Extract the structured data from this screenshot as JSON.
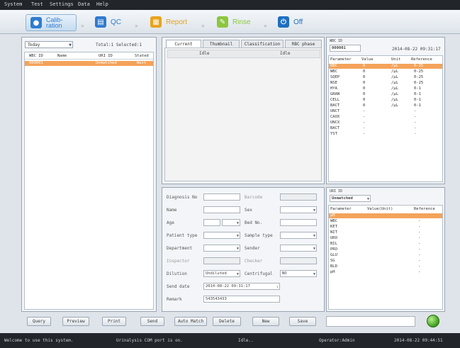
{
  "menu": [
    "System",
    "Test",
    "Settings",
    "Data",
    "Help"
  ],
  "toolbar": {
    "calibration": "Calib-\nration",
    "calibration_l1": "Calib-",
    "calibration_l2": "ration",
    "qc": "QC",
    "report": "Report",
    "rinse": "Rinse",
    "off": "Off",
    "colors": {
      "active": "#2f7bd0",
      "report": "#e8a21a",
      "rinse": "#8cc63f",
      "off": "#1f6fc0"
    }
  },
  "left": {
    "filter": "Today",
    "total": "Total:1 Selected:1",
    "columns": [
      "WBC ID",
      "Name",
      "URI ID",
      "Stated"
    ],
    "rows": [
      {
        "wbc_id": "000001",
        "name": "",
        "uri_id": "Unmatched",
        "stated": "Next"
      }
    ]
  },
  "center": {
    "tabs": [
      "Current",
      "Thumbnail",
      "Classification",
      "RBC phase"
    ],
    "idle_left": "Idle",
    "idle_right": "Idle"
  },
  "form": {
    "diagnosis_no": "Diagnosis No",
    "barcode": "Barcode",
    "name": "Name",
    "sex": "Sex",
    "age": "Age",
    "bed_no": "Bed No.",
    "patient_type": "Patient type",
    "sample_type": "Sample type",
    "department": "Department",
    "sender": "Sender",
    "inspector": "Inspector",
    "checker": "Checker",
    "dilution": "Dilution",
    "dilution_value": "Undiluted",
    "centrifugal": "Centrifugal",
    "centrifugal_value": "NO",
    "send_date": "Send date",
    "send_date_value": "2014-08-22 09:31:17",
    "remark": "Remark",
    "remark_value": "543543433"
  },
  "wbc": {
    "label": "WBC ID",
    "id": "000001",
    "datetime": "2014-08-22 09:31:17",
    "columns": [
      "Parameter",
      "Value",
      "Unit",
      "Reference"
    ],
    "rows": [
      {
        "p": "RBC",
        "v": "0",
        "u": "/μL",
        "r": "0-25",
        "hl": true
      },
      {
        "p": "WBC",
        "v": "0",
        "u": "/μL",
        "r": "0-25"
      },
      {
        "p": "SQEP",
        "v": "0",
        "u": "/μL",
        "r": "0-25"
      },
      {
        "p": "NSE",
        "v": "0",
        "u": "/μL",
        "r": "0-25"
      },
      {
        "p": "HYA",
        "v": "0",
        "u": "/μL",
        "r": "0-1"
      },
      {
        "p": "GRAN",
        "v": "0",
        "u": "/μL",
        "r": "0-1"
      },
      {
        "p": "CELL",
        "v": "0",
        "u": "/μL",
        "r": "0-1"
      },
      {
        "p": "BACT",
        "v": "0",
        "u": "/μL",
        "r": "0-1"
      },
      {
        "p": "UNCT",
        "v": "-",
        "u": "",
        "r": "-"
      },
      {
        "p": "CAOX",
        "v": "-",
        "u": "",
        "r": "-"
      },
      {
        "p": "UNCX",
        "v": "-",
        "u": "",
        "r": "-"
      },
      {
        "p": "BACT",
        "v": "-",
        "u": "",
        "r": "-"
      },
      {
        "p": "YST",
        "v": "-",
        "u": "",
        "r": "-"
      }
    ]
  },
  "uri": {
    "label": "URI ID",
    "select": "Unmatched",
    "columns": [
      "Parameter",
      "Value(Unit)",
      "Reference"
    ],
    "rows": [
      {
        "p": "pH",
        "r": "",
        "hl": true
      },
      {
        "p": "WBC",
        "r": "-"
      },
      {
        "p": "KET",
        "r": "-"
      },
      {
        "p": "NIT",
        "r": "-"
      },
      {
        "p": "URO",
        "r": "-"
      },
      {
        "p": "BIL",
        "r": "-"
      },
      {
        "p": "PRO",
        "r": "-"
      },
      {
        "p": "GLU",
        "r": "-"
      },
      {
        "p": "SG",
        "r": "-"
      },
      {
        "p": "BLD",
        "r": "-"
      },
      {
        "p": "pH",
        "r": "-"
      }
    ]
  },
  "buttons": [
    "Query",
    "Preview",
    "Print",
    "Send",
    "Auto Match",
    "Delete",
    "New",
    "Save"
  ],
  "status": {
    "welcome": "Welcome to use this system.",
    "port": "Urinalysis COM port is on.",
    "state": "Idle..",
    "operator": "Operator:Admin",
    "time": "2014-08-22 09:44:51"
  }
}
